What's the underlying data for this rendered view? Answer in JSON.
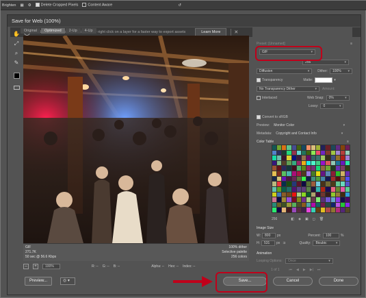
{
  "ps_options": {
    "left_text": "Brighten",
    "delete_cropped": "Delete Cropped Pixels",
    "content_aware": "Content Aware"
  },
  "dialog": {
    "title": "Save for Web (100%)",
    "info_text": "Tip: Use File > Export > Export As... or right click on a layer for a faster way to export assets",
    "learn_more": "Learn More"
  },
  "view_tabs": [
    "Original",
    "Optimized",
    "2-Up",
    "4-Up"
  ],
  "image_info": {
    "left": [
      "GIF",
      "271.7K",
      "50 sec @ 56.6 Kbps"
    ],
    "right": [
      "100% dither",
      "Selective palette",
      "256 colors"
    ]
  },
  "bottom_status": {
    "zoom": "100%",
    "r": "R: --",
    "g": "G: --",
    "b": "B: --",
    "alpha": "Alpha: --",
    "hex": "Hex: --",
    "index": "Index: --"
  },
  "settings": {
    "preset_label": "Preset: [Unnamed]",
    "format": "GIF",
    "colors_value": "256",
    "dither_algo": "Diffusion",
    "dither_label": "Dither:",
    "dither_value": "100%",
    "transparency": "Transparency",
    "matte_label": "Matte:",
    "transparency_dither": "No Transparency Dither",
    "amount_label": "Amount:",
    "interlaced": "Interlaced",
    "web_snap_label": "Web Snap:",
    "web_snap_value": "0%",
    "lossy_label": "Lossy:",
    "lossy_value": "0",
    "convert_srgb": "Convert to sRGB",
    "preview_label": "Preview:",
    "preview_value": "Monitor Color",
    "metadata_label": "Metadata:",
    "metadata_value": "Copyright and Contact Info"
  },
  "color_table": {
    "title": "Color Table",
    "count": "256"
  },
  "image_size": {
    "title": "Image Size",
    "w_label": "W:",
    "w_value": "800",
    "h_label": "H:",
    "h_value": "531",
    "unit": "px",
    "percent_label": "Percent:",
    "percent_value": "100",
    "percent_unit": "%",
    "quality_label": "Quality:",
    "quality_value": "Bicubic"
  },
  "animation": {
    "title": "Animation",
    "looping_label": "Looping Options:",
    "looping_value": "Once",
    "frame_text": "1 of 1"
  },
  "buttons": {
    "preview": "Preview...",
    "save": "Save...",
    "cancel": "Cancel",
    "done": "Done"
  }
}
